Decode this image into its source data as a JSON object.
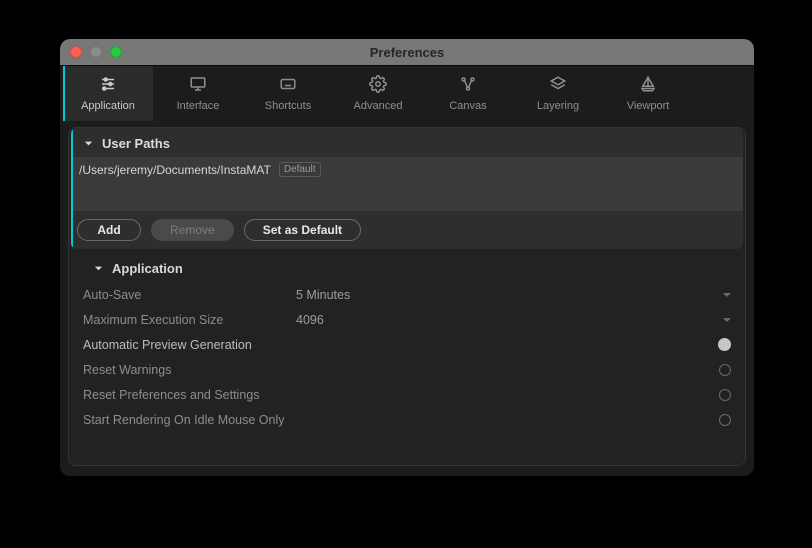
{
  "window": {
    "title": "Preferences"
  },
  "tabs": [
    {
      "id": "application",
      "label": "Application",
      "icon": "sliders-icon",
      "active": true
    },
    {
      "id": "interface",
      "label": "Interface",
      "icon": "monitor-icon"
    },
    {
      "id": "shortcuts",
      "label": "Shortcuts",
      "icon": "keyboard-icon"
    },
    {
      "id": "advanced",
      "label": "Advanced",
      "icon": "gear-icon"
    },
    {
      "id": "canvas",
      "label": "Canvas",
      "icon": "node-icon"
    },
    {
      "id": "layering",
      "label": "Layering",
      "icon": "layers-icon"
    },
    {
      "id": "viewport",
      "label": "Viewport",
      "icon": "sailboat-icon"
    }
  ],
  "user_paths": {
    "section_label": "User Paths",
    "entries": [
      {
        "path": "/Users/jeremy/Documents/InstaMAT",
        "default_badge": "Default"
      }
    ],
    "buttons": {
      "add": "Add",
      "remove": "Remove",
      "set_default": "Set as Default"
    }
  },
  "application_section": {
    "section_label": "Application",
    "auto_save": {
      "label": "Auto-Save",
      "value": "5 Minutes"
    },
    "max_exec_size": {
      "label": "Maximum Execution Size",
      "value": "4096"
    },
    "auto_preview": {
      "label": "Automatic Preview Generation",
      "enabled": true
    },
    "reset_warnings": {
      "label": "Reset Warnings"
    },
    "reset_prefs": {
      "label": "Reset Preferences and Settings"
    },
    "idle_mouse_render": {
      "label": "Start Rendering On Idle Mouse Only"
    }
  }
}
